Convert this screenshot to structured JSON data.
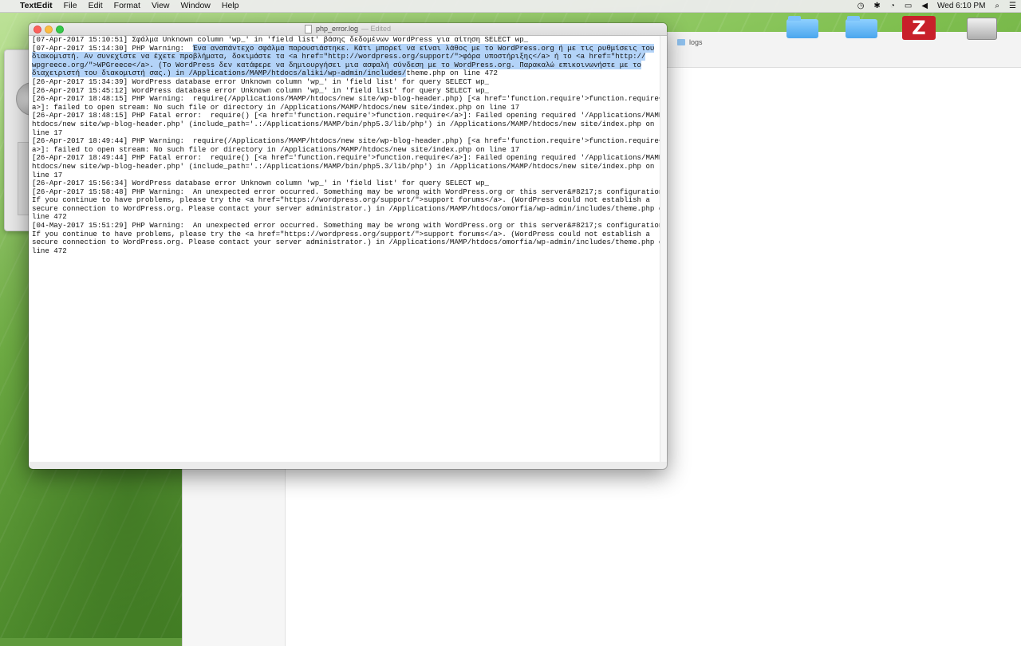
{
  "menubar": {
    "apple_glyph": "",
    "app_name": "TextEdit",
    "items": [
      "File",
      "Edit",
      "Format",
      "View",
      "Window",
      "Help"
    ],
    "clock": "Wed 6:10 PM"
  },
  "finder": {
    "path_label": "logs"
  },
  "desktop": {
    "filezilla_letter": "Z"
  },
  "textedit": {
    "filename": "php_error.log",
    "status": "— Edited",
    "lines": [
      "[07-Apr-2017 15:10:51] Σφάλμα Unknown column 'wp_' in 'field list' βάσης δεδομένων WordPress για αίτηση SELECT wp_",
      "[07-Apr-2017 15:14:30] PHP Warning:  ",
      "[26-Apr-2017 15:34:39] WordPress database error Unknown column 'wp_' in 'field list' for query SELECT wp_",
      "[26-Apr-2017 15:45:12] WordPress database error Unknown column 'wp_' in 'field list' for query SELECT wp_",
      "[26-Apr-2017 18:48:15] PHP Warning:  require(/Applications/MAMP/htdocs/new site/wp-blog-header.php) [<a href='function.require'>function.require</",
      "a>]: failed to open stream: No such file or directory in /Applications/MAMP/htdocs/new site/index.php on line 17",
      "[26-Apr-2017 18:48:15] PHP Fatal error:  require() [<a href='function.require'>function.require</a>]: Failed opening required '/Applications/MAMP/",
      "htdocs/new site/wp-blog-header.php' (include_path='.:/Applications/MAMP/bin/php5.3/lib/php') in /Applications/MAMP/htdocs/new site/index.php on",
      "line 17",
      "[26-Apr-2017 18:49:44] PHP Warning:  require(/Applications/MAMP/htdocs/new site/wp-blog-header.php) [<a href='function.require'>function.require</",
      "a>]: failed to open stream: No such file or directory in /Applications/MAMP/htdocs/new site/index.php on line 17",
      "[26-Apr-2017 18:49:44] PHP Fatal error:  require() [<a href='function.require'>function.require</a>]: Failed opening required '/Applications/MAMP/",
      "htdocs/new site/wp-blog-header.php' (include_path='.:/Applications/MAMP/bin/php5.3/lib/php') in /Applications/MAMP/htdocs/new site/index.php on",
      "line 17",
      "[26-Apr-2017 15:56:34] WordPress database error Unknown column 'wp_' in 'field list' for query SELECT wp_",
      "[26-Apr-2017 15:58:48] PHP Warning:  An unexpected error occurred. Something may be wrong with WordPress.org or this server&#8217;s configuration.",
      "If you continue to have problems, please try the <a href=\"https://wordpress.org/support/\">support forums</a>. (WordPress could not establish a",
      "secure connection to WordPress.org. Please contact your server administrator.) in /Applications/MAMP/htdocs/omorfia/wp-admin/includes/theme.php on",
      "line 472",
      "[04-May-2017 15:51:29] PHP Warning:  An unexpected error occurred. Something may be wrong with WordPress.org or this server&#8217;s configuration.",
      "If you continue to have problems, please try the <a href=\"https://wordpress.org/support/\">support forums</a>. (WordPress could not establish a",
      "secure connection to WordPress.org. Please contact your server administrator.) in /Applications/MAMP/htdocs/omorfia/wp-admin/includes/theme.php on",
      "line 472"
    ],
    "selected_text": "Ένα αναπάντεχο σφάλμα παρουσιάστηκε. Κάτι μπορεί να είναι λάθος με το WordPress.org ή με τις ρυθμίσεις του\nδιακομιστή. Αν συνεχίστε να έχετε προβλήματα, δοκιμάστε τα <a href=\"http://wordpress.org/support/\">φόρα υποστήριξης</a> ή το <a href=\"http://\nwpgreece.org/\">WPGreece</a>. (Το WordPress δεν κατάφερε να δημιουργήσει μια ασφαλή σύνδεση με το WordPress.org. Παρακαλώ επικοινωνήστε με το\nδιαχειριστή του διακομιστή σας.) in /Applications/MAMP/htdocs/aliki/wp-admin/includes/",
    "selected_tail": "theme.php on line 472"
  }
}
